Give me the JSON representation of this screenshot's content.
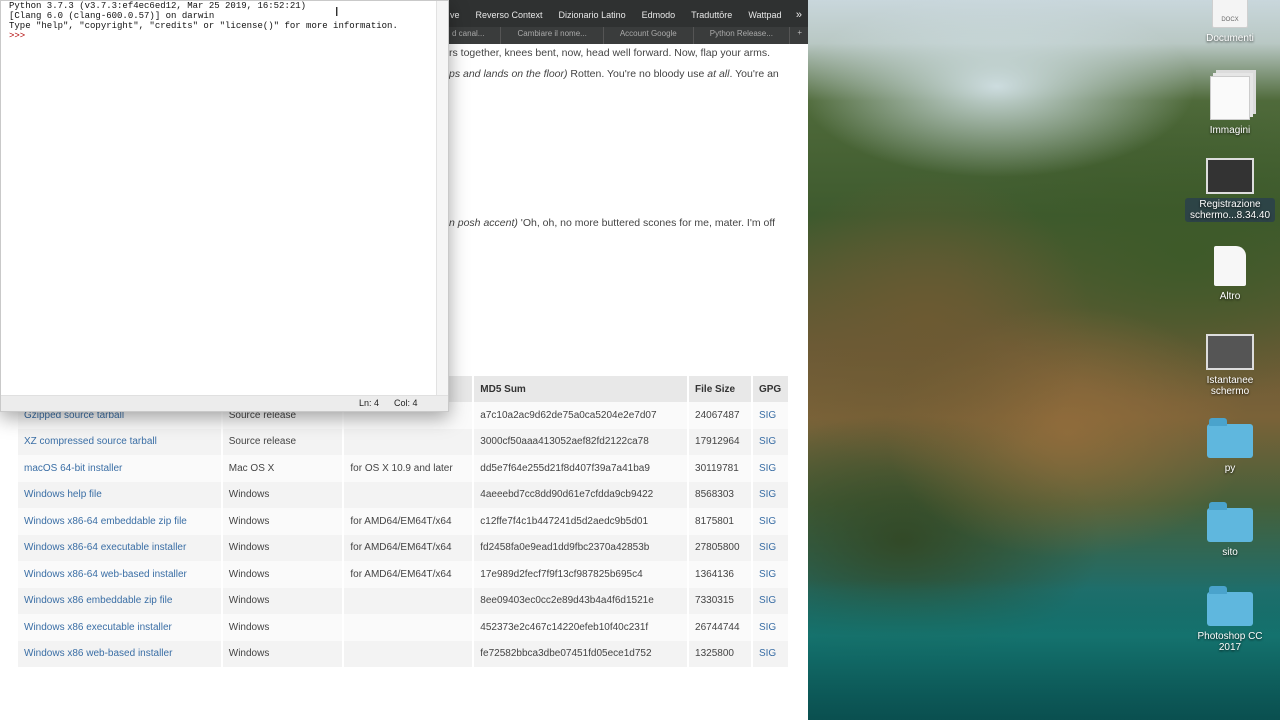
{
  "browser": {
    "bookmarks": [
      "ve",
      "Reverso Context",
      "Dizionario Latino",
      "Edmodo",
      "Traduttōre",
      "Wattpad"
    ],
    "more_glyph": "»",
    "tabs": [
      "d canal...",
      "Cambiare il nome...",
      "Account Google",
      "Python Release..."
    ],
    "new_tab_glyph": "+",
    "prose": {
      "line1": "rs together, knees bent, now, head well forward. Now, flap your arms.",
      "line2_italic": "ps and lands on the floor)",
      "line2_rest": " Rotten. You're no bloody use ",
      "line2_italic2": "at all",
      "line2_end": ". You're an",
      "line3_italic": "n posh accent)",
      "line3_rest": " 'Oh, oh, no more buttered scones for me, mater. I'm off"
    },
    "files_table": {
      "headers": [
        "",
        "",
        "",
        "MD5 Sum",
        "File Size",
        "GPG"
      ],
      "rows": [
        {
          "name": "Gzipped source tarball",
          "os": "Source release",
          "desc": "",
          "md5": "a7c10a2ac9d62de75a0ca5204e2e7d07",
          "size": "24067487",
          "gpg": "SIG"
        },
        {
          "name": "XZ compressed source tarball",
          "os": "Source release",
          "desc": "",
          "md5": "3000cf50aaa413052aef82fd2122ca78",
          "size": "17912964",
          "gpg": "SIG"
        },
        {
          "name": "macOS 64-bit installer",
          "os": "Mac OS X",
          "desc": "for OS X 10.9 and later",
          "md5": "dd5e7f64e255d21f8d407f39a7a41ba9",
          "size": "30119781",
          "gpg": "SIG"
        },
        {
          "name": "Windows help file",
          "os": "Windows",
          "desc": "",
          "md5": "4aeeebd7cc8dd90d61e7cfdda9cb9422",
          "size": "8568303",
          "gpg": "SIG"
        },
        {
          "name": "Windows x86-64 embeddable zip file",
          "os": "Windows",
          "desc": "for AMD64/EM64T/x64",
          "md5": "c12ffe7f4c1b447241d5d2aedc9b5d01",
          "size": "8175801",
          "gpg": "SIG"
        },
        {
          "name": "Windows x86-64 executable installer",
          "os": "Windows",
          "desc": "for AMD64/EM64T/x64",
          "md5": "fd2458fa0e9ead1dd9fbc2370a42853b",
          "size": "27805800",
          "gpg": "SIG"
        },
        {
          "name": "Windows x86-64 web-based installer",
          "os": "Windows",
          "desc": "for AMD64/EM64T/x64",
          "md5": "17e989d2fecf7f9f13cf987825b695c4",
          "size": "1364136",
          "gpg": "SIG"
        },
        {
          "name": "Windows x86 embeddable zip file",
          "os": "Windows",
          "desc": "",
          "md5": "8ee09403ec0cc2e89d43b4a4f6d1521e",
          "size": "7330315",
          "gpg": "SIG"
        },
        {
          "name": "Windows x86 executable installer",
          "os": "Windows",
          "desc": "",
          "md5": "452373e2c467c14220efeb10f40c231f",
          "size": "26744744",
          "gpg": "SIG"
        },
        {
          "name": "Windows x86 web-based installer",
          "os": "Windows",
          "desc": "",
          "md5": "fe72582bbca3dbe07451fd05ece1d752",
          "size": "1325800",
          "gpg": "SIG"
        }
      ]
    }
  },
  "idle": {
    "line1": "Python 3.7.3 (v3.7.3:ef4ec6ed12, Mar 25 2019, 16:52:21)",
    "line2": "[Clang 6.0 (clang-600.0.57)] on darwin",
    "line3": "Type \"help\", \"copyright\", \"credits\" or \"license()\" for more information.",
    "prompt": ">>> ",
    "status_ln": "Ln: 4",
    "status_col": "Col: 4"
  },
  "desktop": {
    "icons": [
      {
        "label": "Documenti",
        "tag": "DOCX",
        "icon": "document-icon"
      },
      {
        "label": "Immagini",
        "icon": "image-stack-icon"
      },
      {
        "label": "Registrazione schermo...8.34.40",
        "icon": "screen-recording-icon"
      },
      {
        "label": "Altro",
        "icon": "file-icon"
      },
      {
        "label": "Istantanee schermo",
        "icon": "screenshot-stack-icon"
      },
      {
        "label": "py",
        "icon": "folder-icon"
      },
      {
        "label": "sito",
        "icon": "folder-icon"
      },
      {
        "label": "Photoshop CC 2017",
        "icon": "folder-icon"
      }
    ]
  },
  "colors": {
    "link": "#3a6ea5",
    "prompt": "#b00000",
    "folder": "#5fb7de"
  }
}
